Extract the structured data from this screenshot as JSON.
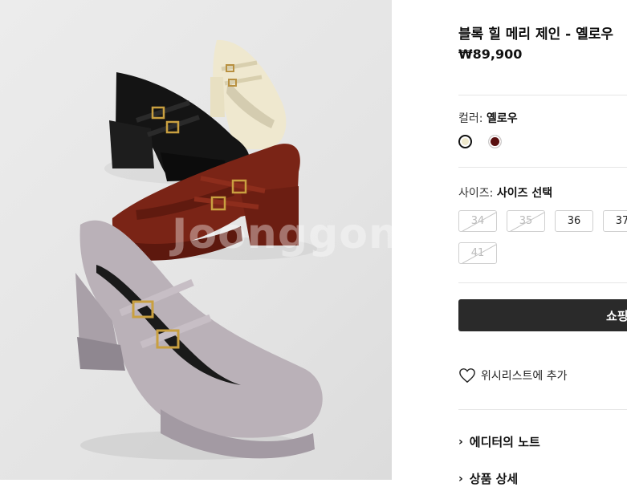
{
  "product": {
    "title": "블록 힐 메리 제인 - 옐로우",
    "price": "₩89,900"
  },
  "photo": {
    "watermark": "Joonggonar"
  },
  "color": {
    "label": "컬러:",
    "value": "옐로우",
    "swatches": [
      {
        "name": "옐로우",
        "hex": "#efe9cc",
        "selected": true
      },
      {
        "name": "burgundy",
        "hex": "#5a0f0f",
        "selected": false
      }
    ]
  },
  "size": {
    "label": "사이즈:",
    "value": "사이즈 선택",
    "options": [
      {
        "label": "34",
        "available": false
      },
      {
        "label": "35",
        "available": false
      },
      {
        "label": "36",
        "available": true
      },
      {
        "label": "37",
        "available": true
      },
      {
        "label": "41",
        "available": false
      }
    ]
  },
  "actions": {
    "shop_label": "쇼핑",
    "wishlist_label": "위시리스트에 추가"
  },
  "accordion": [
    {
      "label": "에디터의 노트"
    },
    {
      "label": "상품 상세"
    }
  ]
}
